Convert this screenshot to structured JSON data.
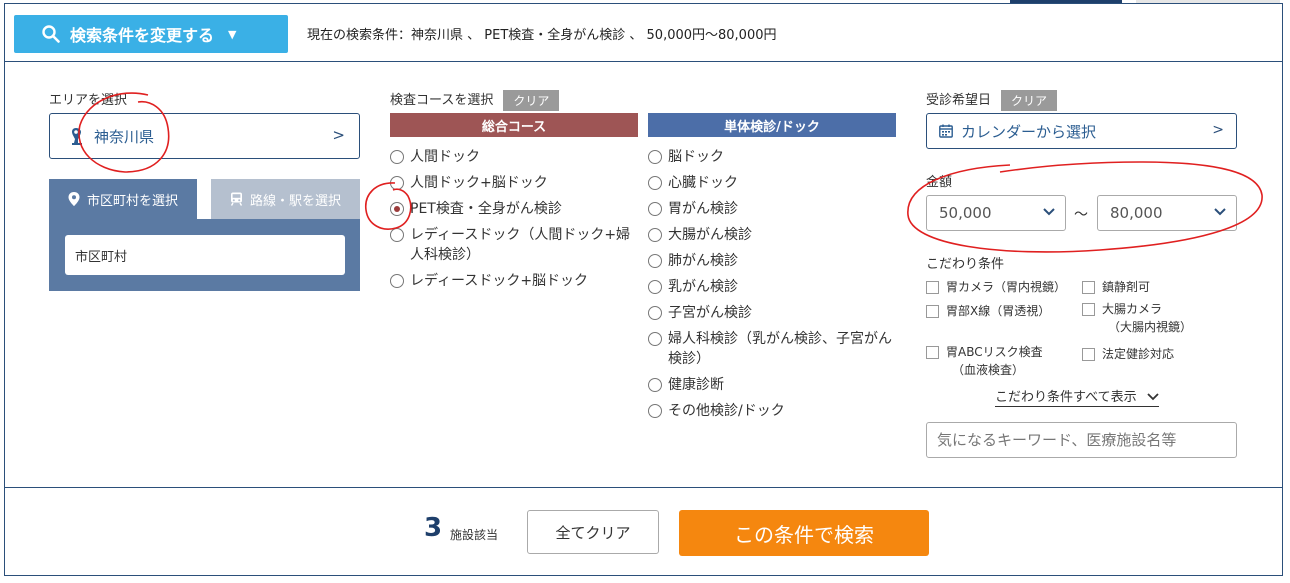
{
  "header": {
    "change_button_label": "検索条件を変更する",
    "current_conditions": "現在の検索条件：神奈川県 、 PET検査・全身がん検診 、 50,000円〜80,000円"
  },
  "area": {
    "label": "エリアを選択",
    "selected": "神奈川県",
    "arrow": ">",
    "tabs": [
      {
        "label": "市区町村を選択"
      },
      {
        "label": "路線・駅を選択"
      }
    ],
    "city_value": "市区町村"
  },
  "course": {
    "label": "検査コースを選択",
    "clear_label": "クリア",
    "columns": [
      {
        "title": "総合コース",
        "items": [
          {
            "label": "人間ドック"
          },
          {
            "label": "人間ドック+脳ドック"
          },
          {
            "label": "PET検査・全身がん検診"
          },
          {
            "label": "レディースドック（人間ドック+婦人科検診）"
          },
          {
            "label": "レディースドック+脳ドック"
          }
        ]
      },
      {
        "title": "単体検診/ドック",
        "items": [
          {
            "label": "脳ドック"
          },
          {
            "label": "心臓ドック"
          },
          {
            "label": "胃がん検診"
          },
          {
            "label": "大腸がん検診"
          },
          {
            "label": "肺がん検診"
          },
          {
            "label": "乳がん検診"
          },
          {
            "label": "子宮がん検診"
          },
          {
            "label": "婦人科検診（乳がん検診、子宮がん検診）"
          },
          {
            "label": "健康診断"
          },
          {
            "label": "その他検診/ドック"
          }
        ]
      }
    ]
  },
  "date": {
    "label": "受診希望日",
    "clear_label": "クリア",
    "calendar_label": "カレンダーから選択",
    "arrow": ">"
  },
  "price": {
    "label": "金額",
    "min": "50,000",
    "separator": "〜",
    "max": "80,000"
  },
  "options": {
    "label": "こだわり条件",
    "items": [
      {
        "label": "胃カメラ（胃内視鏡）",
        "sub": ""
      },
      {
        "label": "鎮静剤可",
        "sub": ""
      },
      {
        "label": "胃部X線（胃透視）",
        "sub": ""
      },
      {
        "label": "大腸カメラ",
        "sub": "（大腸内視鏡）"
      },
      {
        "label": "胃ABCリスク検査",
        "sub": "（血液検査）"
      },
      {
        "label": "法定健診対応",
        "sub": ""
      }
    ],
    "show_all": "こだわり条件すべて表示",
    "keyword_placeholder": "気になるキーワード、医療施設名等"
  },
  "footer": {
    "count": "3",
    "count_label": "施設該当",
    "clear_all": "全てクリア",
    "search": "この条件で検索"
  },
  "colors": {
    "primary": "#2b4f7a",
    "accent_blue": "#3ab0e6",
    "course_general": "#9e5555",
    "course_single": "#4c6ea8",
    "search_orange": "#f5870f",
    "annotation": "#e02020"
  }
}
